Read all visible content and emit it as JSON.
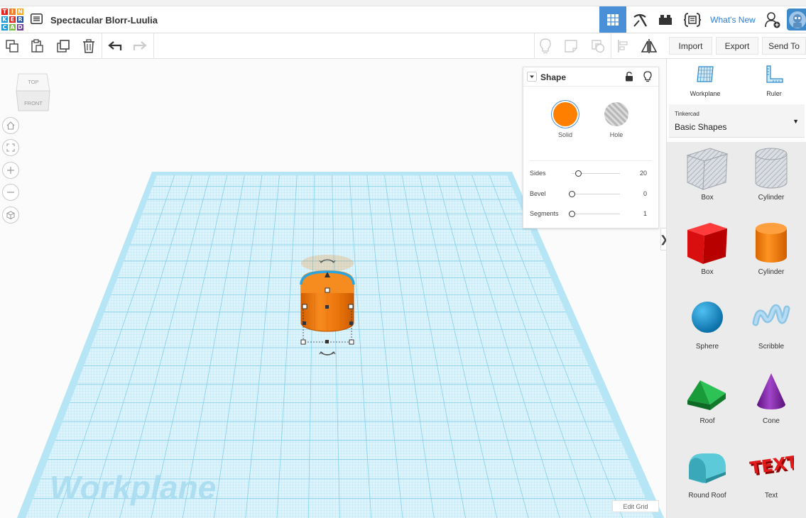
{
  "header": {
    "logo_letters": [
      "T",
      "I",
      "N",
      "K",
      "E",
      "R",
      "C",
      "A",
      "D"
    ],
    "logo_colors": [
      "#e2231a",
      "#f47b20",
      "#f9a51b",
      "#1a9ad6",
      "#e2231a",
      "#1e4c9a",
      "#1a9ad6",
      "#7ac143",
      "#6a3d98"
    ],
    "project_title": "Spectacular Blorr-Luulia",
    "whats_new_label": "What's New",
    "accent_color": "#4a90d9"
  },
  "toolbar": {
    "import_label": "Import",
    "export_label": "Export",
    "send_to_label": "Send To"
  },
  "view_cube": {
    "top_label": "TOP",
    "front_label": "FRONT"
  },
  "canvas": {
    "workplane_label": "Workplane",
    "edit_grid_label": "Edit Grid",
    "panel_toggle": "❯",
    "grid_color": "#8fd3ec",
    "shape_color": "#f57c00"
  },
  "inspector": {
    "title": "Shape",
    "solid_label": "Solid",
    "hole_label": "Hole",
    "solid_color": "#ff7f00",
    "properties": [
      {
        "label": "Sides",
        "value": "20",
        "slider_fraction": 0.13
      },
      {
        "label": "Bevel",
        "value": "0",
        "slider_fraction": 0.0
      },
      {
        "label": "Segments",
        "value": "1",
        "slider_fraction": 0.0
      }
    ]
  },
  "side_panel": {
    "workplane_label": "Workplane",
    "ruler_label": "Ruler",
    "library_caption": "Tinkercad",
    "library_name": "Basic Shapes",
    "shapes": [
      {
        "label": "Box",
        "icon": "box-hole-icon"
      },
      {
        "label": "Cylinder",
        "icon": "cylinder-hole-icon"
      },
      {
        "label": "Box",
        "icon": "box-red-icon"
      },
      {
        "label": "Cylinder",
        "icon": "cylinder-orange-icon"
      },
      {
        "label": "Sphere",
        "icon": "sphere-icon"
      },
      {
        "label": "Scribble",
        "icon": "scribble-icon"
      },
      {
        "label": "Roof",
        "icon": "roof-icon"
      },
      {
        "label": "Cone",
        "icon": "cone-icon"
      },
      {
        "label": "Round Roof",
        "icon": "round-roof-icon"
      },
      {
        "label": "Text",
        "icon": "text-shape-icon"
      }
    ]
  }
}
